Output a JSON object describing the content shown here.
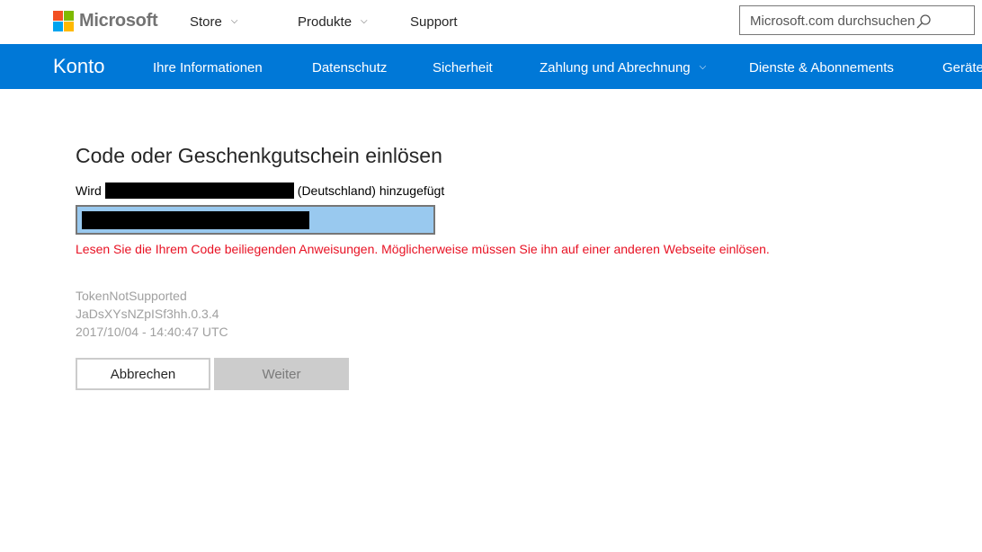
{
  "header": {
    "logo_text": "Microsoft",
    "nav": [
      {
        "label": "Store",
        "has_dropdown": true
      },
      {
        "label": "Produkte",
        "has_dropdown": true
      },
      {
        "label": "Support",
        "has_dropdown": false
      }
    ],
    "search": {
      "placeholder": "Microsoft.com durchsuchen",
      "icon": "search-icon"
    }
  },
  "account_nav": {
    "brand": "Konto",
    "items": [
      {
        "label": "Ihre Informationen"
      },
      {
        "label": "Datenschutz"
      },
      {
        "label": "Sicherheit"
      },
      {
        "label": "Zahlung und Abrechnung",
        "has_dropdown": true
      },
      {
        "label": "Dienste & Abonnements"
      },
      {
        "label": "Geräte"
      }
    ],
    "background": "#0078d7"
  },
  "main": {
    "title": "Code oder Geschenkgutschein einlösen",
    "added_prefix": "Wird",
    "added_suffix": "(Deutschland) hinzugefügt",
    "error_message": "Lesen Sie die Ihrem Code beiliegenden Anweisungen. Möglicherweise müssen Sie ihn auf einer anderen Webseite einlösen.",
    "error_color": "#e81123",
    "meta_lines": [
      "TokenNotSupported",
      "JaDsXYsNZpISf3hh.0.3.4",
      "2017/10/04 - 14:40:47 UTC"
    ],
    "buttons": {
      "cancel": "Abbrechen",
      "next": "Weiter"
    }
  }
}
